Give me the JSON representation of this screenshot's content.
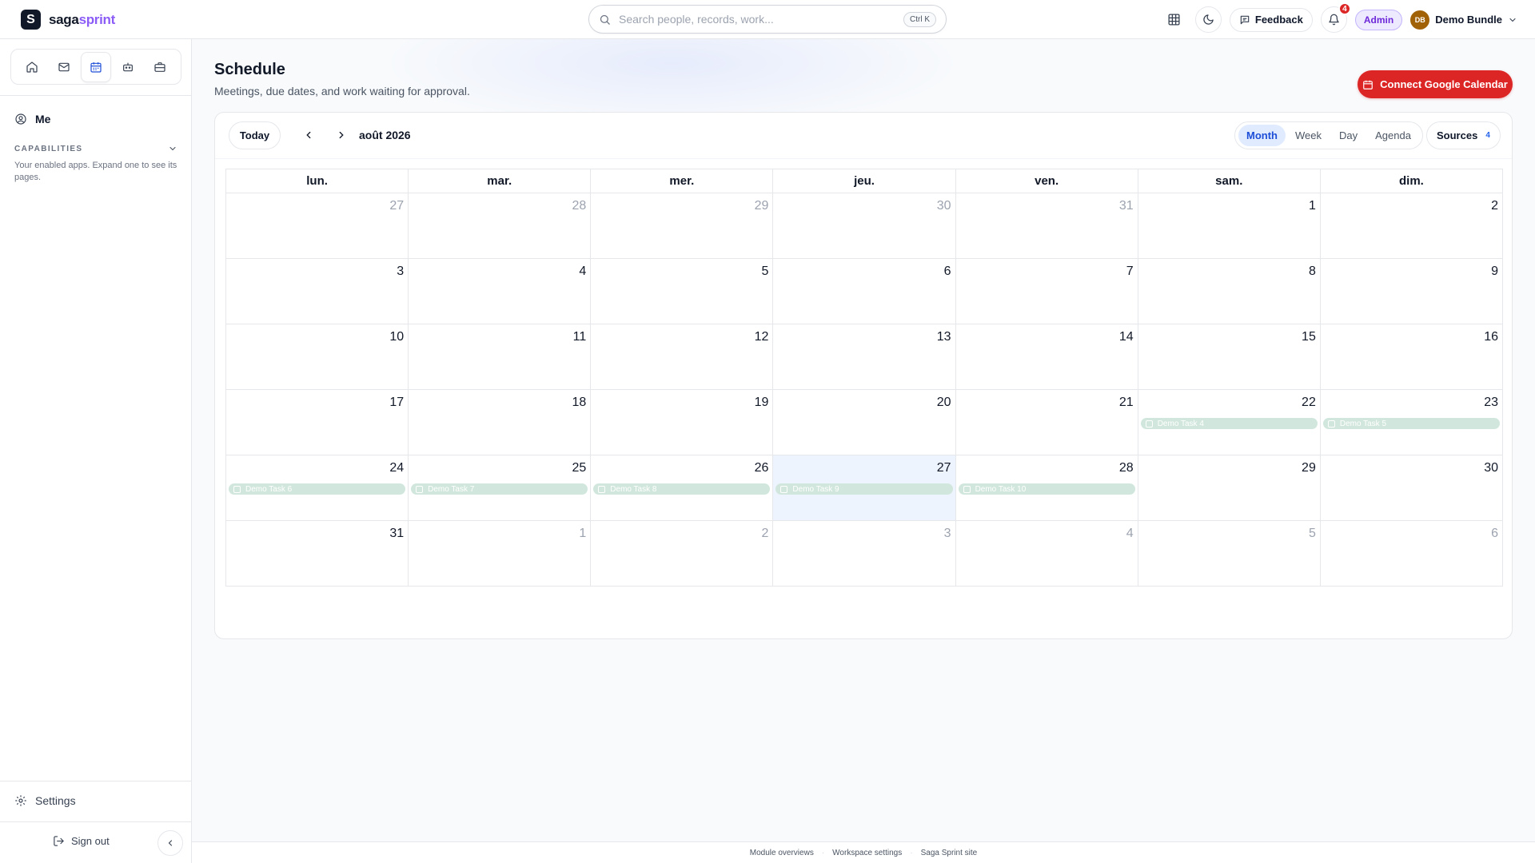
{
  "brand": {
    "mark": "S",
    "name_a": "saga",
    "name_b": "sprint"
  },
  "search": {
    "placeholder": "Search people, records, work...",
    "shortcut": "Ctrl K"
  },
  "topbar": {
    "feedback_label": "Feedback",
    "notification_count": "4",
    "role_badge": "Admin",
    "user_initials": "DB",
    "user_name": "Demo Bundle"
  },
  "sidebar": {
    "apps": [
      {
        "icon": "home-icon"
      },
      {
        "icon": "mail-icon"
      },
      {
        "icon": "calendar-icon",
        "active": true
      },
      {
        "icon": "bot-icon"
      },
      {
        "icon": "briefcase-icon"
      }
    ],
    "me_label": "Me",
    "capabilities_title": "CAPABILITIES",
    "capabilities_desc": "Your enabled apps. Expand one to see its pages.",
    "settings_label": "Settings",
    "signout_label": "Sign out"
  },
  "page": {
    "title": "Schedule",
    "subtitle": "Meetings, due dates, and work waiting for approval.",
    "connect_button": "Connect Google Calendar"
  },
  "calendar": {
    "today_label": "Today",
    "month_label": "août 2026",
    "views": [
      "Month",
      "Week",
      "Day",
      "Agenda"
    ],
    "active_view": "Month",
    "sources_label": "Sources",
    "sources_count": "4",
    "weekdays": [
      "lun.",
      "mar.",
      "mer.",
      "jeu.",
      "ven.",
      "sam.",
      "dim."
    ],
    "weeks": [
      [
        {
          "n": "27",
          "m": true
        },
        {
          "n": "28",
          "m": true
        },
        {
          "n": "29",
          "m": true
        },
        {
          "n": "30",
          "m": true
        },
        {
          "n": "31",
          "m": true
        },
        {
          "n": "1"
        },
        {
          "n": "2"
        }
      ],
      [
        {
          "n": "3"
        },
        {
          "n": "4"
        },
        {
          "n": "5"
        },
        {
          "n": "6"
        },
        {
          "n": "7"
        },
        {
          "n": "8"
        },
        {
          "n": "9"
        }
      ],
      [
        {
          "n": "10"
        },
        {
          "n": "11"
        },
        {
          "n": "12"
        },
        {
          "n": "13"
        },
        {
          "n": "14"
        },
        {
          "n": "15"
        },
        {
          "n": "16"
        }
      ],
      [
        {
          "n": "17"
        },
        {
          "n": "18"
        },
        {
          "n": "19"
        },
        {
          "n": "20"
        },
        {
          "n": "21"
        },
        {
          "n": "22",
          "event": "Demo Task 4"
        },
        {
          "n": "23",
          "event": "Demo Task 5"
        }
      ],
      [
        {
          "n": "24",
          "event": "Demo Task 6"
        },
        {
          "n": "25",
          "event": "Demo Task 7"
        },
        {
          "n": "26",
          "event": "Demo Task 8"
        },
        {
          "n": "27",
          "event": "Demo Task 9",
          "today": true
        },
        {
          "n": "28",
          "event": "Demo Task 10"
        },
        {
          "n": "29"
        },
        {
          "n": "30"
        }
      ],
      [
        {
          "n": "31"
        },
        {
          "n": "1",
          "m": true
        },
        {
          "n": "2",
          "m": true
        },
        {
          "n": "3",
          "m": true
        },
        {
          "n": "4",
          "m": true
        },
        {
          "n": "5",
          "m": true
        },
        {
          "n": "6",
          "m": true
        }
      ]
    ]
  },
  "footer": {
    "links": [
      "Module overviews",
      "Workspace settings",
      "Saga Sprint site"
    ]
  },
  "colors": {
    "accent": "#dc2626",
    "brand_purple": "#8b5cf6",
    "event_bg": "#d1e7dd",
    "today_bg": "#eef4fd",
    "active_view": "#1d4ed8"
  }
}
